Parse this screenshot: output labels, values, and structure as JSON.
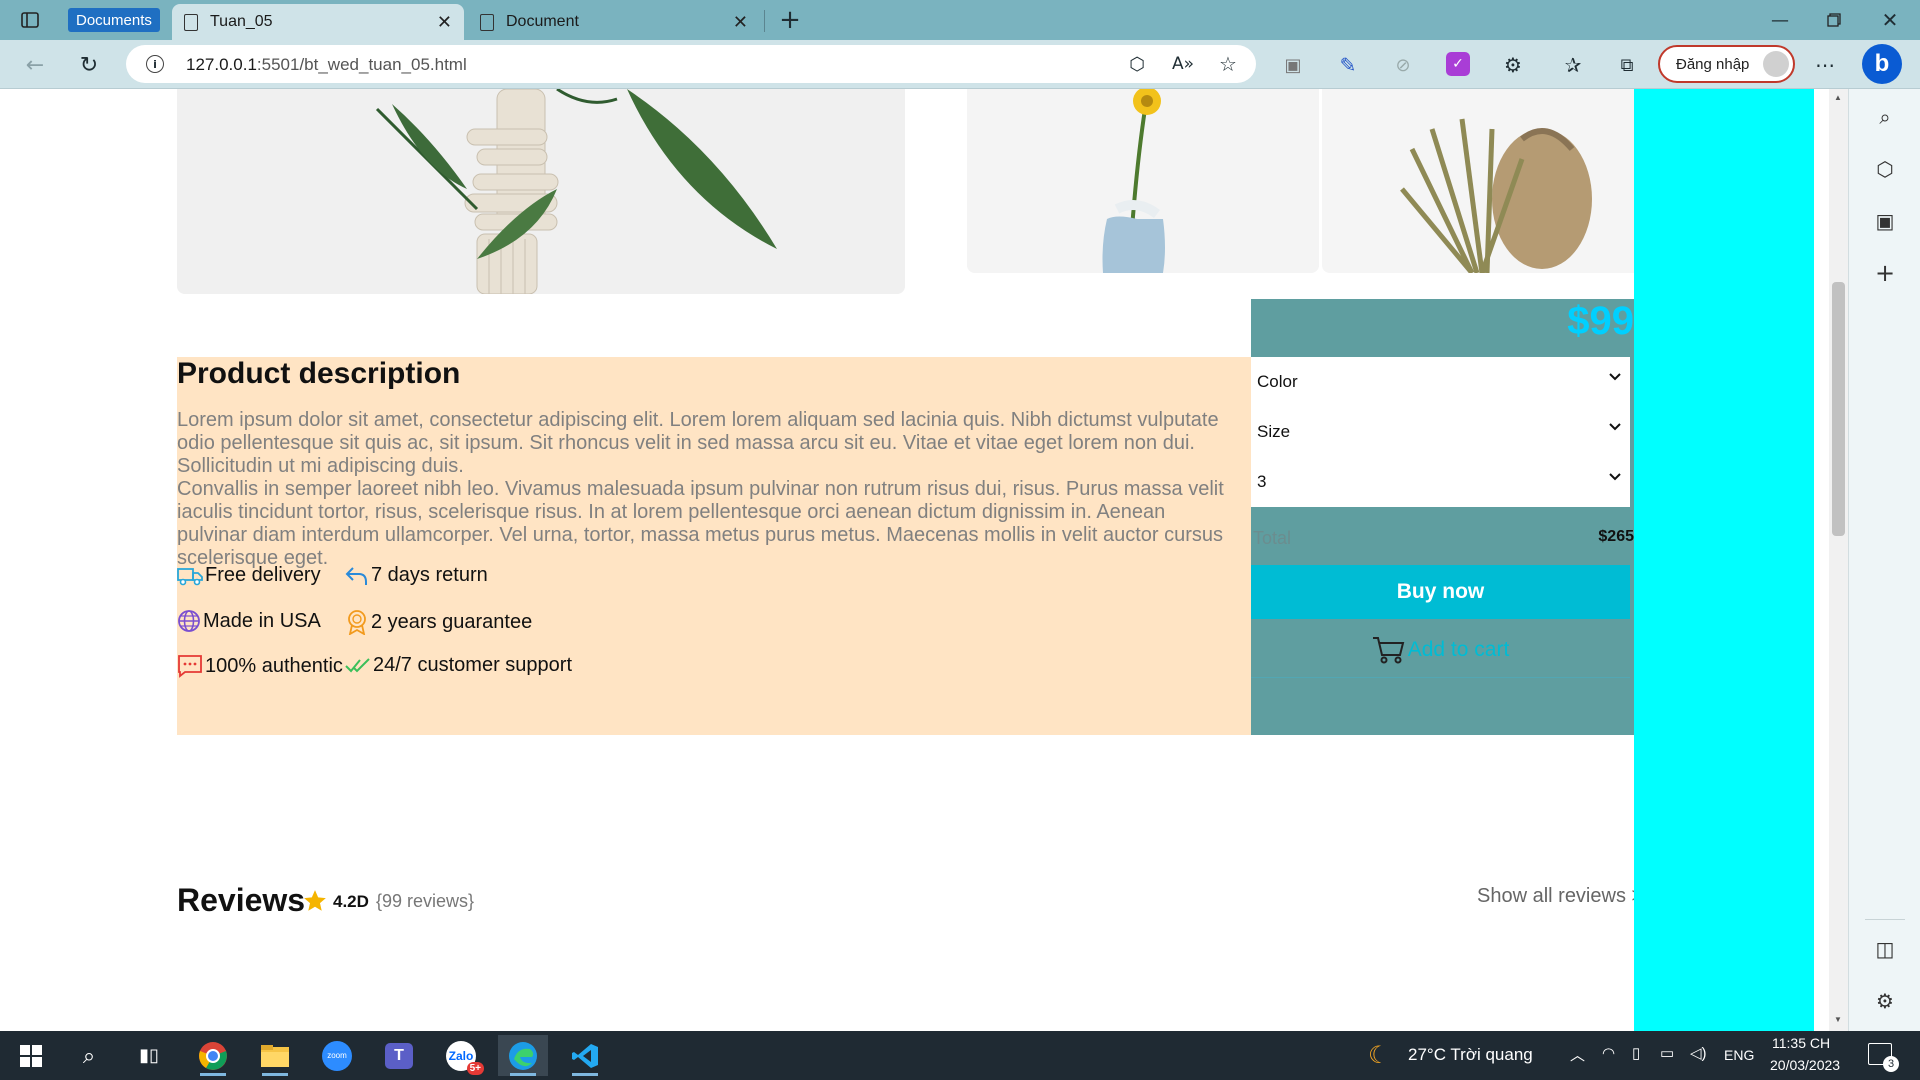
{
  "browser": {
    "tab_group_label": "Documents",
    "tabs": [
      {
        "title": "Tuan_05",
        "active": true
      },
      {
        "title": "Document",
        "active": false
      }
    ],
    "url_host": "127.0.0.1",
    "url_rest": ":5501/bt_wed_tuan_05.html",
    "login_label": "Đăng nhập",
    "accent": "#7ab3bf"
  },
  "product": {
    "price": "$99",
    "selects": [
      {
        "label": "Color"
      },
      {
        "label": "Size"
      },
      {
        "label": "3"
      }
    ],
    "total_label": "Total",
    "total_value": "$265",
    "buy_now": "Buy now",
    "add_to_cart": "Add to cart"
  },
  "description": {
    "title": "Product description",
    "paragraph_1": "Lorem ipsum dolor sit amet, consectetur adipiscing elit. Lorem lorem aliquam sed lacinia quis. Nibh dictumst vulputate odio pellentesque sit quis ac, sit ipsum. Sit rhoncus velit in sed massa arcu sit eu. Vitae et vitae eget lorem non dui. Sollicitudin ut mi adipiscing duis.",
    "paragraph_2": "Convallis in semper laoreet nibh leo. Vivamus malesuada ipsum pulvinar non rutrum risus dui, risus. Purus massa velit iaculis tincidunt tortor, risus, scelerisque risus. In at lorem pellentesque orci aenean dictum dignissim in. Aenean pulvinar diam interdum ullamcorper. Vel urna, tortor, massa metus purus metus. Maecenas mollis in velit auctor cursus scelerisque eget."
  },
  "features": [
    {
      "label": "Free delivery",
      "icon": "truck-icon"
    },
    {
      "label": "7 days return",
      "icon": "return-arrow-icon"
    },
    {
      "label": "Made in USA",
      "icon": "globe-icon"
    },
    {
      "label": "2 years guarantee",
      "icon": "award-icon"
    },
    {
      "label": "100% authentic",
      "icon": "chat-icon"
    },
    {
      "label": "24/7 customer support",
      "icon": "double-check-icon"
    }
  ],
  "reviews": {
    "title": "Reviews",
    "rating": "4.2D",
    "count": "{99 reviews}",
    "show_all": "Show all reviews >"
  },
  "taskbar": {
    "weather": "27°C  Trời quang",
    "lang": "ENG",
    "time": "11:35 CH",
    "date": "20/03/2023",
    "notifications": "3",
    "zalo_badge": "5+"
  }
}
